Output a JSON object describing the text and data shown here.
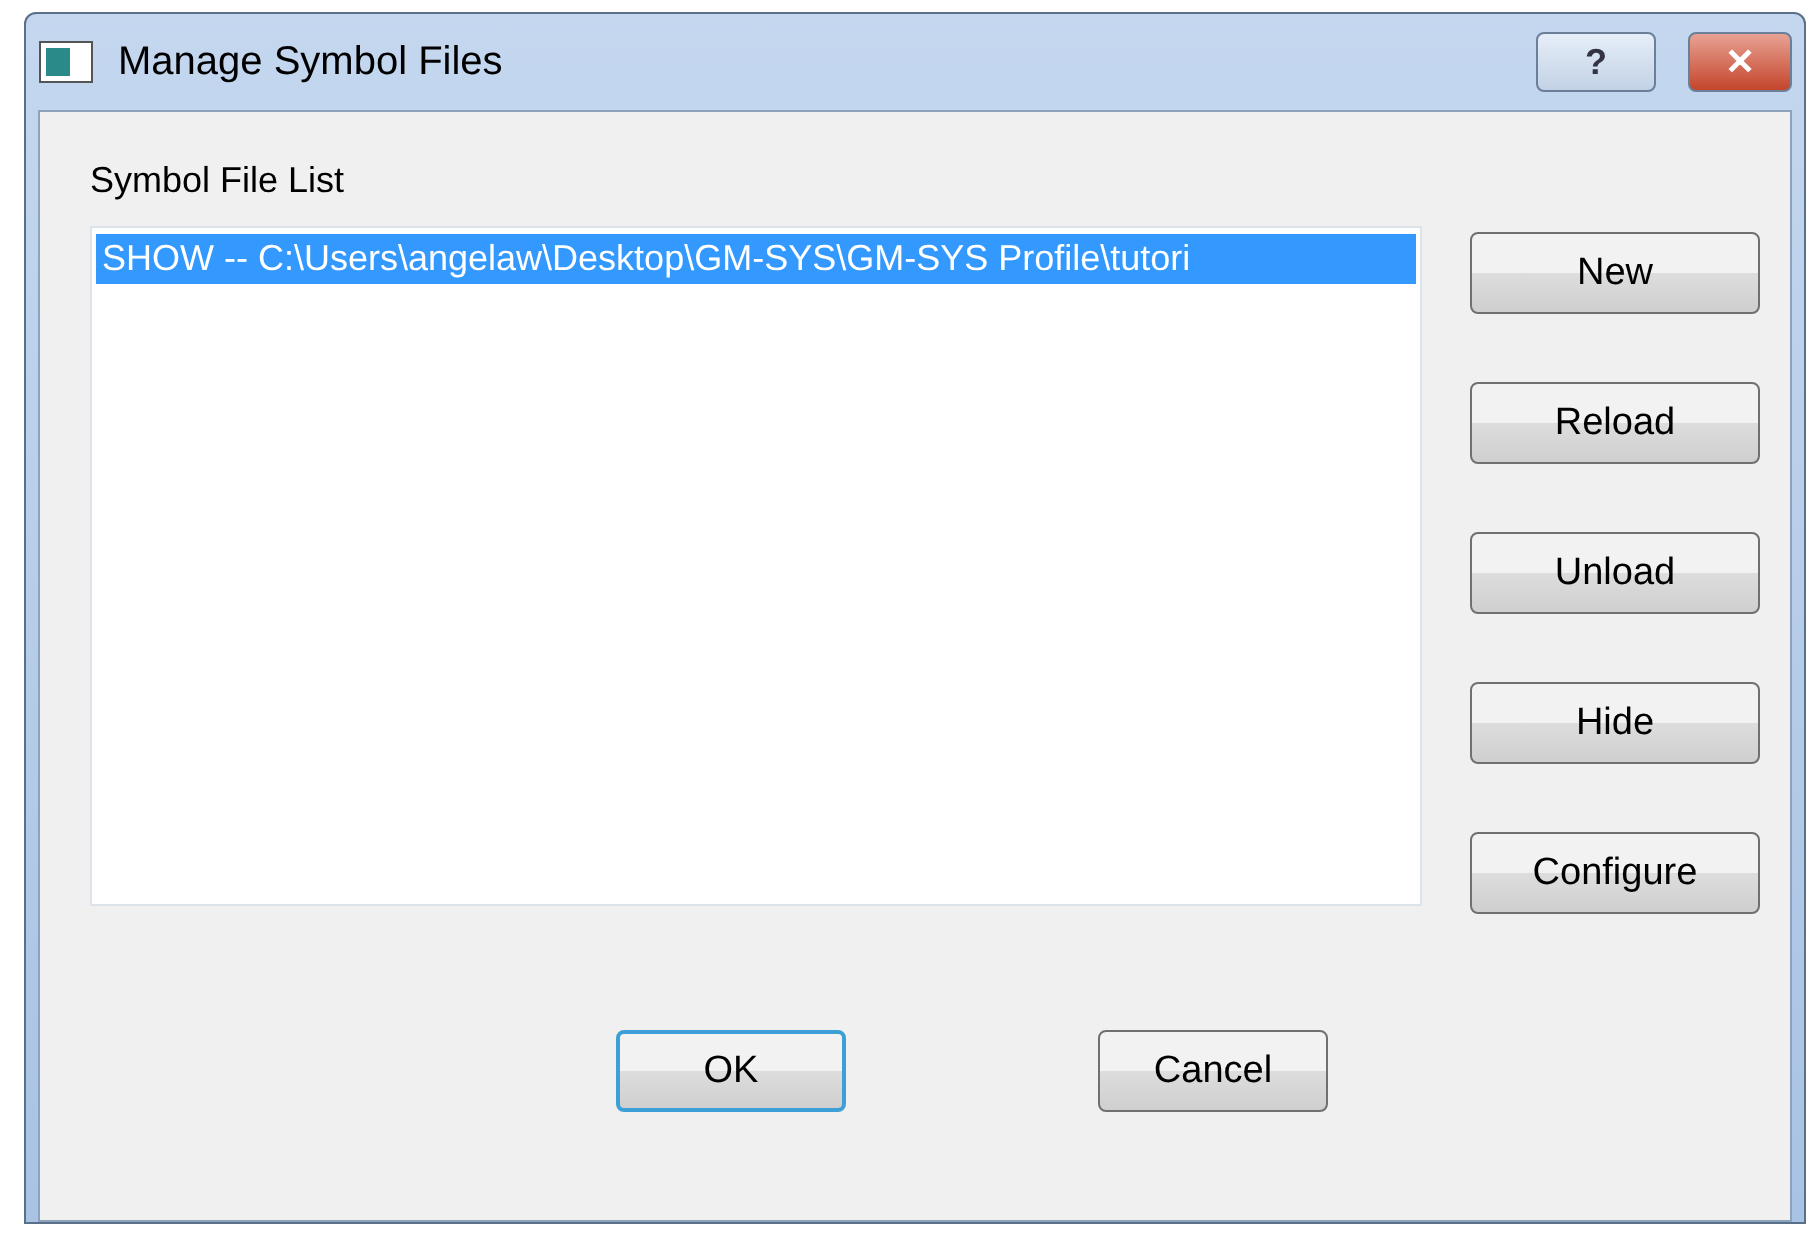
{
  "window": {
    "title": "Manage Symbol Files",
    "controls": [
      "?",
      "✕"
    ]
  },
  "list": {
    "label": "Symbol File List",
    "items": [
      {
        "text": "SHOW -- C:\\Users\\angelaw\\Desktop\\GM-SYS\\GM-SYS Profile\\tutori",
        "selected": true
      }
    ]
  },
  "side_buttons": [
    "New",
    "Reload",
    "Unload",
    "Hide",
    "Configure"
  ],
  "dialog_buttons": [
    {
      "label": "OK",
      "default": true
    },
    {
      "label": "Cancel",
      "default": false
    }
  ]
}
